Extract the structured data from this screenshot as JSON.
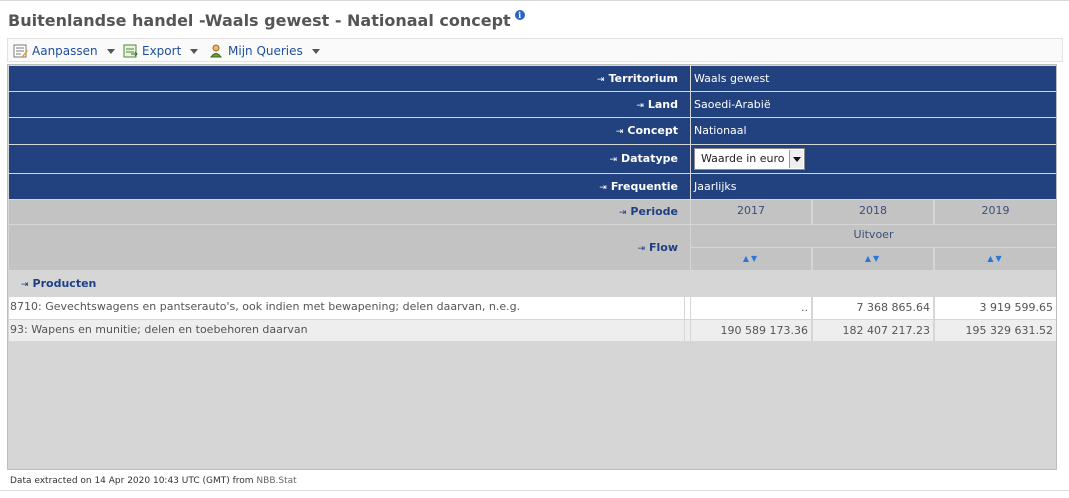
{
  "page": {
    "title": "Buitenlandse handel -Waals gewest - Nationaal concept",
    "info_icon": "info-icon"
  },
  "toolbar": {
    "items": [
      {
        "label": "Aanpassen",
        "icon": "customize-icon"
      },
      {
        "label": "Export",
        "icon": "export-icon"
      },
      {
        "label": "Mijn Queries",
        "icon": "user-queries-icon"
      }
    ]
  },
  "dimensions": [
    {
      "label": "Territorium",
      "value": "Waals gewest"
    },
    {
      "label": "Land",
      "value": "Saoedi-Arabië"
    },
    {
      "label": "Concept",
      "value": "Nationaal"
    },
    {
      "label": "Datatype",
      "value": "Waarde in euro"
    },
    {
      "label": "Frequentie",
      "value": "Jaarlijks"
    }
  ],
  "header": {
    "periode_label": "Periode",
    "flow_label": "Flow",
    "years": [
      "2017",
      "2018",
      "2019"
    ],
    "flow_value": "Uitvoer"
  },
  "producten_label": "Producten",
  "rows": [
    {
      "desc": "8710: Gevechtswagens en pantserauto's, ook indien met bewapening; delen daarvan, n.e.g.",
      "values": [
        "..",
        "7 368 865.64",
        "3 919 599.65"
      ]
    },
    {
      "desc": "93: Wapens en munitie; delen en toebehoren daarvan",
      "values": [
        "190 589 173.36",
        "182 407 217.23",
        "195 329 631.52"
      ]
    }
  ],
  "footer": {
    "text": "Data extracted on 14 Apr 2020 10:43 UTC (GMT) from",
    "source": "NBB.Stat"
  },
  "colors": {
    "header_blue": "#21417f",
    "header_grey": "#c3c3c3",
    "link_blue": "#1d4f9c"
  }
}
